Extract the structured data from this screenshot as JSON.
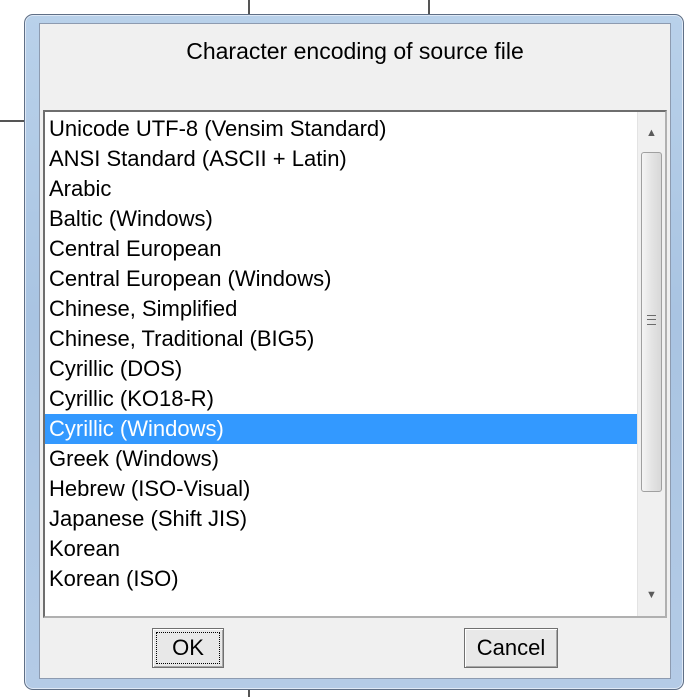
{
  "dialog": {
    "title": "Character encoding of source file"
  },
  "listbox": {
    "items": [
      "Unicode UTF-8 (Vensim Standard)",
      "ANSI Standard (ASCII + Latin)",
      "Arabic",
      "Baltic (Windows)",
      "Central European",
      "Central European (Windows)",
      "Chinese, Simplified",
      "Chinese, Traditional (BIG5)",
      "Cyrillic (DOS)",
      "Cyrillic (KO18-R)",
      "Cyrillic (Windows)",
      "Greek (Windows)",
      "Hebrew (ISO-Visual)",
      "Japanese (Shift JIS)",
      "Korean",
      "Korean (ISO)"
    ],
    "selected_index": 10,
    "selected_value": "Cyrillic (Windows)"
  },
  "scrollbar": {
    "up_icon": "scroll-up-arrow-icon",
    "down_icon": "scroll-down-arrow-icon",
    "grip_icon": "scroll-thumb-grip-icon"
  },
  "buttons": {
    "ok_label": "OK",
    "cancel_label": "Cancel"
  },
  "colors": {
    "selection": "#3399ff",
    "frame": "#b9d1ea"
  }
}
